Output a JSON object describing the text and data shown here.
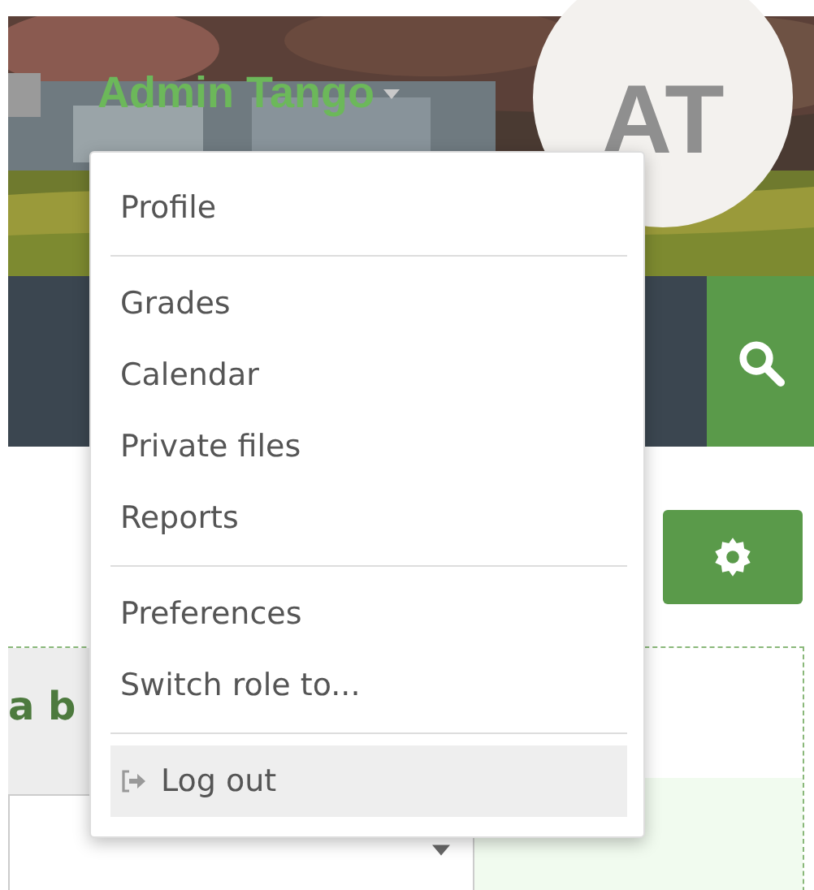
{
  "header": {
    "user_name": "Admin Tango",
    "avatar_initials": "AT"
  },
  "user_menu": [
    {
      "kind": "item",
      "label": "Profile",
      "selected": false
    },
    {
      "kind": "divider"
    },
    {
      "kind": "item",
      "label": "Grades",
      "selected": false
    },
    {
      "kind": "item",
      "label": "Calendar",
      "selected": false
    },
    {
      "kind": "item",
      "label": "Private files",
      "selected": false
    },
    {
      "kind": "item",
      "label": "Reports",
      "selected": false
    },
    {
      "kind": "divider"
    },
    {
      "kind": "item",
      "label": "Preferences",
      "selected": false
    },
    {
      "kind": "item",
      "label": "Switch role to...",
      "selected": false
    },
    {
      "kind": "divider"
    },
    {
      "kind": "logout",
      "label": "Log out",
      "selected": true
    }
  ],
  "block": {
    "heading": "a b"
  }
}
